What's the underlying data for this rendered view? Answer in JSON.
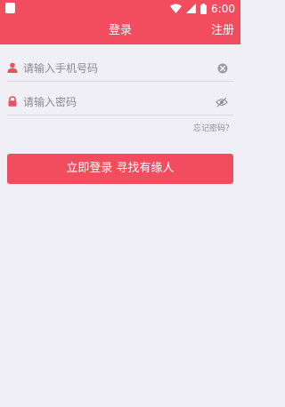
{
  "status_bar": {
    "time": "6:00"
  },
  "header": {
    "title": "登录",
    "register_label": "注册"
  },
  "form": {
    "phone": {
      "placeholder": "请输入手机号码",
      "value": ""
    },
    "password": {
      "placeholder": "请输入密码",
      "value": ""
    },
    "forgot_label": "忘记密码？",
    "submit_label": "立即登录 寻找有缘人"
  },
  "icons": {
    "user": "user-icon",
    "lock": "lock-icon",
    "clear": "clear-icon",
    "visibility": "eye-hidden-icon"
  },
  "colors": {
    "primary": "#f24d5f",
    "background": "#f0eff5",
    "placeholder": "#8a8a8f",
    "divider": "#d9d9de"
  }
}
